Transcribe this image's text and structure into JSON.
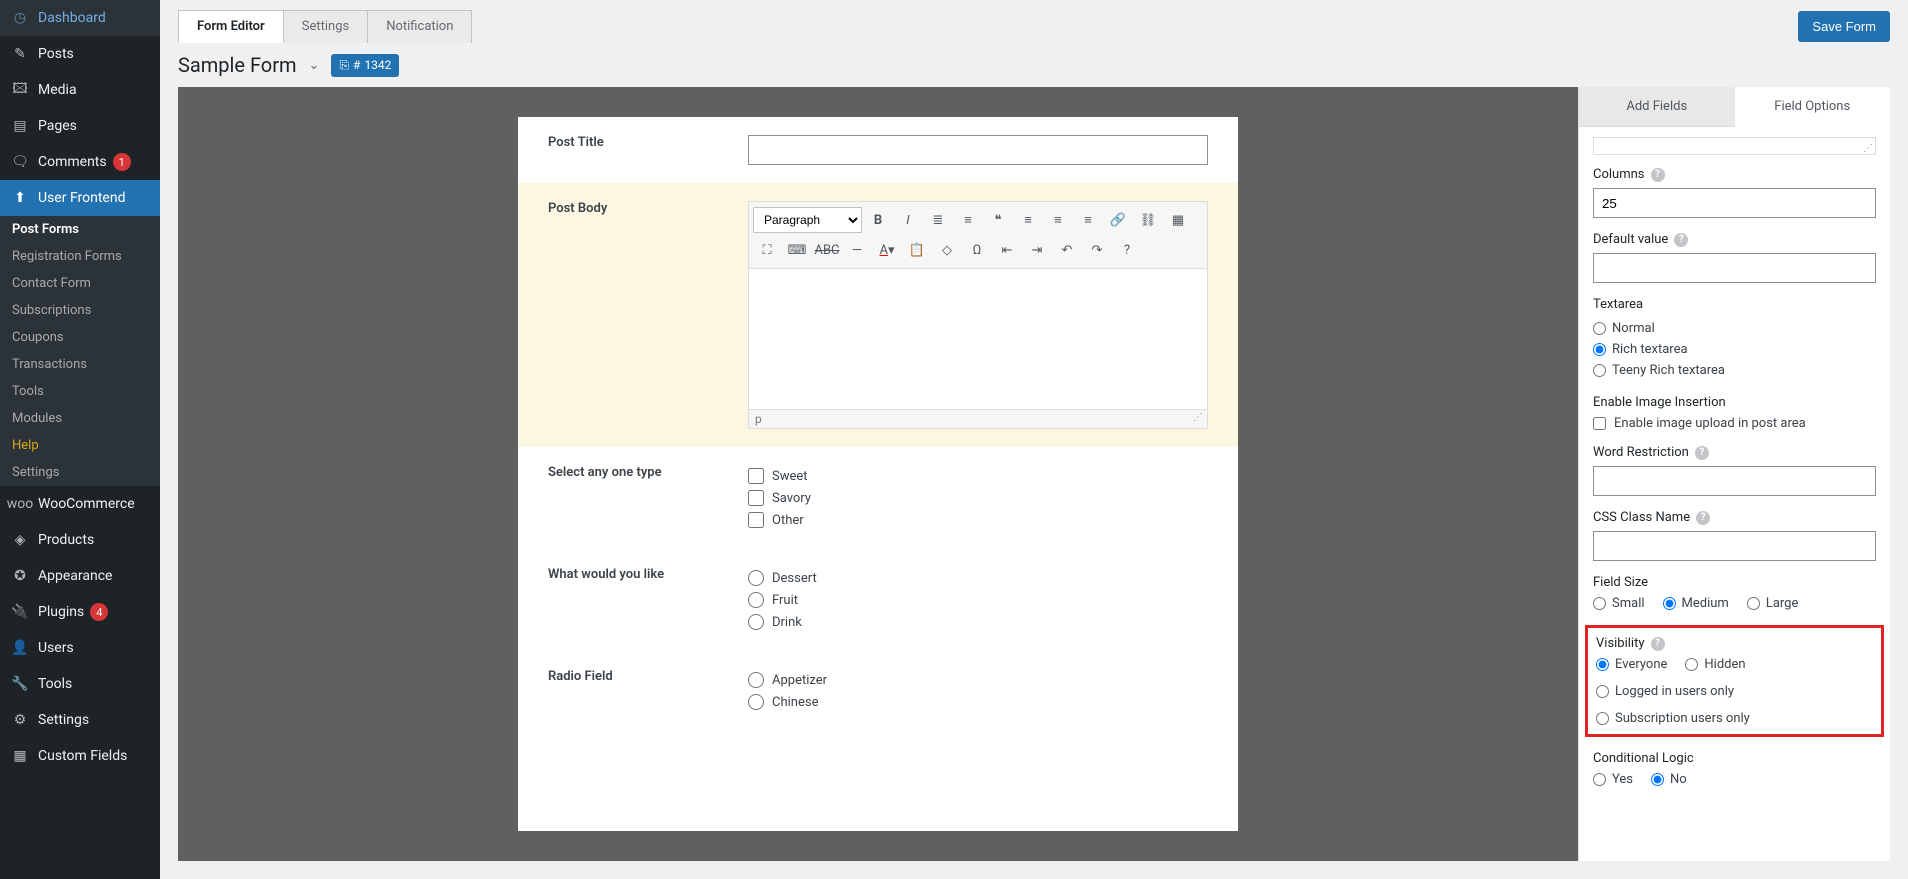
{
  "sidebar": {
    "items": [
      {
        "icon": "◷",
        "label": "Dashboard"
      },
      {
        "icon": "✎",
        "label": "Posts"
      },
      {
        "icon": "🖾",
        "label": "Media"
      },
      {
        "icon": "▤",
        "label": "Pages"
      },
      {
        "icon": "🗨",
        "label": "Comments",
        "badge": "1"
      },
      {
        "icon": "⬆",
        "label": "User Frontend",
        "active": true
      },
      {
        "icon": "woo",
        "label": "WooCommerce"
      },
      {
        "icon": "◈",
        "label": "Products"
      },
      {
        "icon": "✪",
        "label": "Appearance"
      },
      {
        "icon": "🔌",
        "label": "Plugins",
        "badge": "4"
      },
      {
        "icon": "👤",
        "label": "Users"
      },
      {
        "icon": "🔧",
        "label": "Tools"
      },
      {
        "icon": "⚙",
        "label": "Settings"
      },
      {
        "icon": "▦",
        "label": "Custom Fields"
      }
    ],
    "sub": [
      "Post Forms",
      "Registration Forms",
      "Contact Form",
      "Subscriptions",
      "Coupons",
      "Transactions",
      "Tools",
      "Modules",
      "Help",
      "Settings"
    ]
  },
  "tabs": [
    "Form Editor",
    "Settings",
    "Notification"
  ],
  "save_label": "Save Form",
  "form_name": "Sample Form",
  "form_id_prefix": "#",
  "form_id": "1342",
  "preview": {
    "post_title_label": "Post Title",
    "post_body_label": "Post Body",
    "paragraph_label": "Paragraph",
    "path_text": "p",
    "checkbox_label": "Select any one type",
    "checkbox_opts": [
      "Sweet",
      "Savory",
      "Other"
    ],
    "radio1_label": "What would you like",
    "radio1_opts": [
      "Dessert",
      "Fruit",
      "Drink"
    ],
    "radio2_label": "Radio Field",
    "radio2_opts": [
      "Appetizer",
      "Chinese"
    ]
  },
  "rp_tabs": [
    "Add Fields",
    "Field Options"
  ],
  "options": {
    "columns_label": "Columns",
    "columns_value": "25",
    "default_label": "Default value",
    "textarea_label": "Textarea",
    "textarea_opts": [
      "Normal",
      "Rich textarea",
      "Teeny Rich textarea"
    ],
    "image_ins_label": "Enable Image Insertion",
    "image_ins_check": "Enable image upload in post area",
    "word_label": "Word Restriction",
    "css_label": "CSS Class Name",
    "size_label": "Field Size",
    "size_opts": [
      "Small",
      "Medium",
      "Large"
    ],
    "vis_label": "Visibility",
    "vis_opts": [
      "Everyone",
      "Hidden",
      "Logged in users only",
      "Subscription users only"
    ],
    "cond_label": "Conditional Logic",
    "cond_opts": [
      "Yes",
      "No"
    ]
  }
}
